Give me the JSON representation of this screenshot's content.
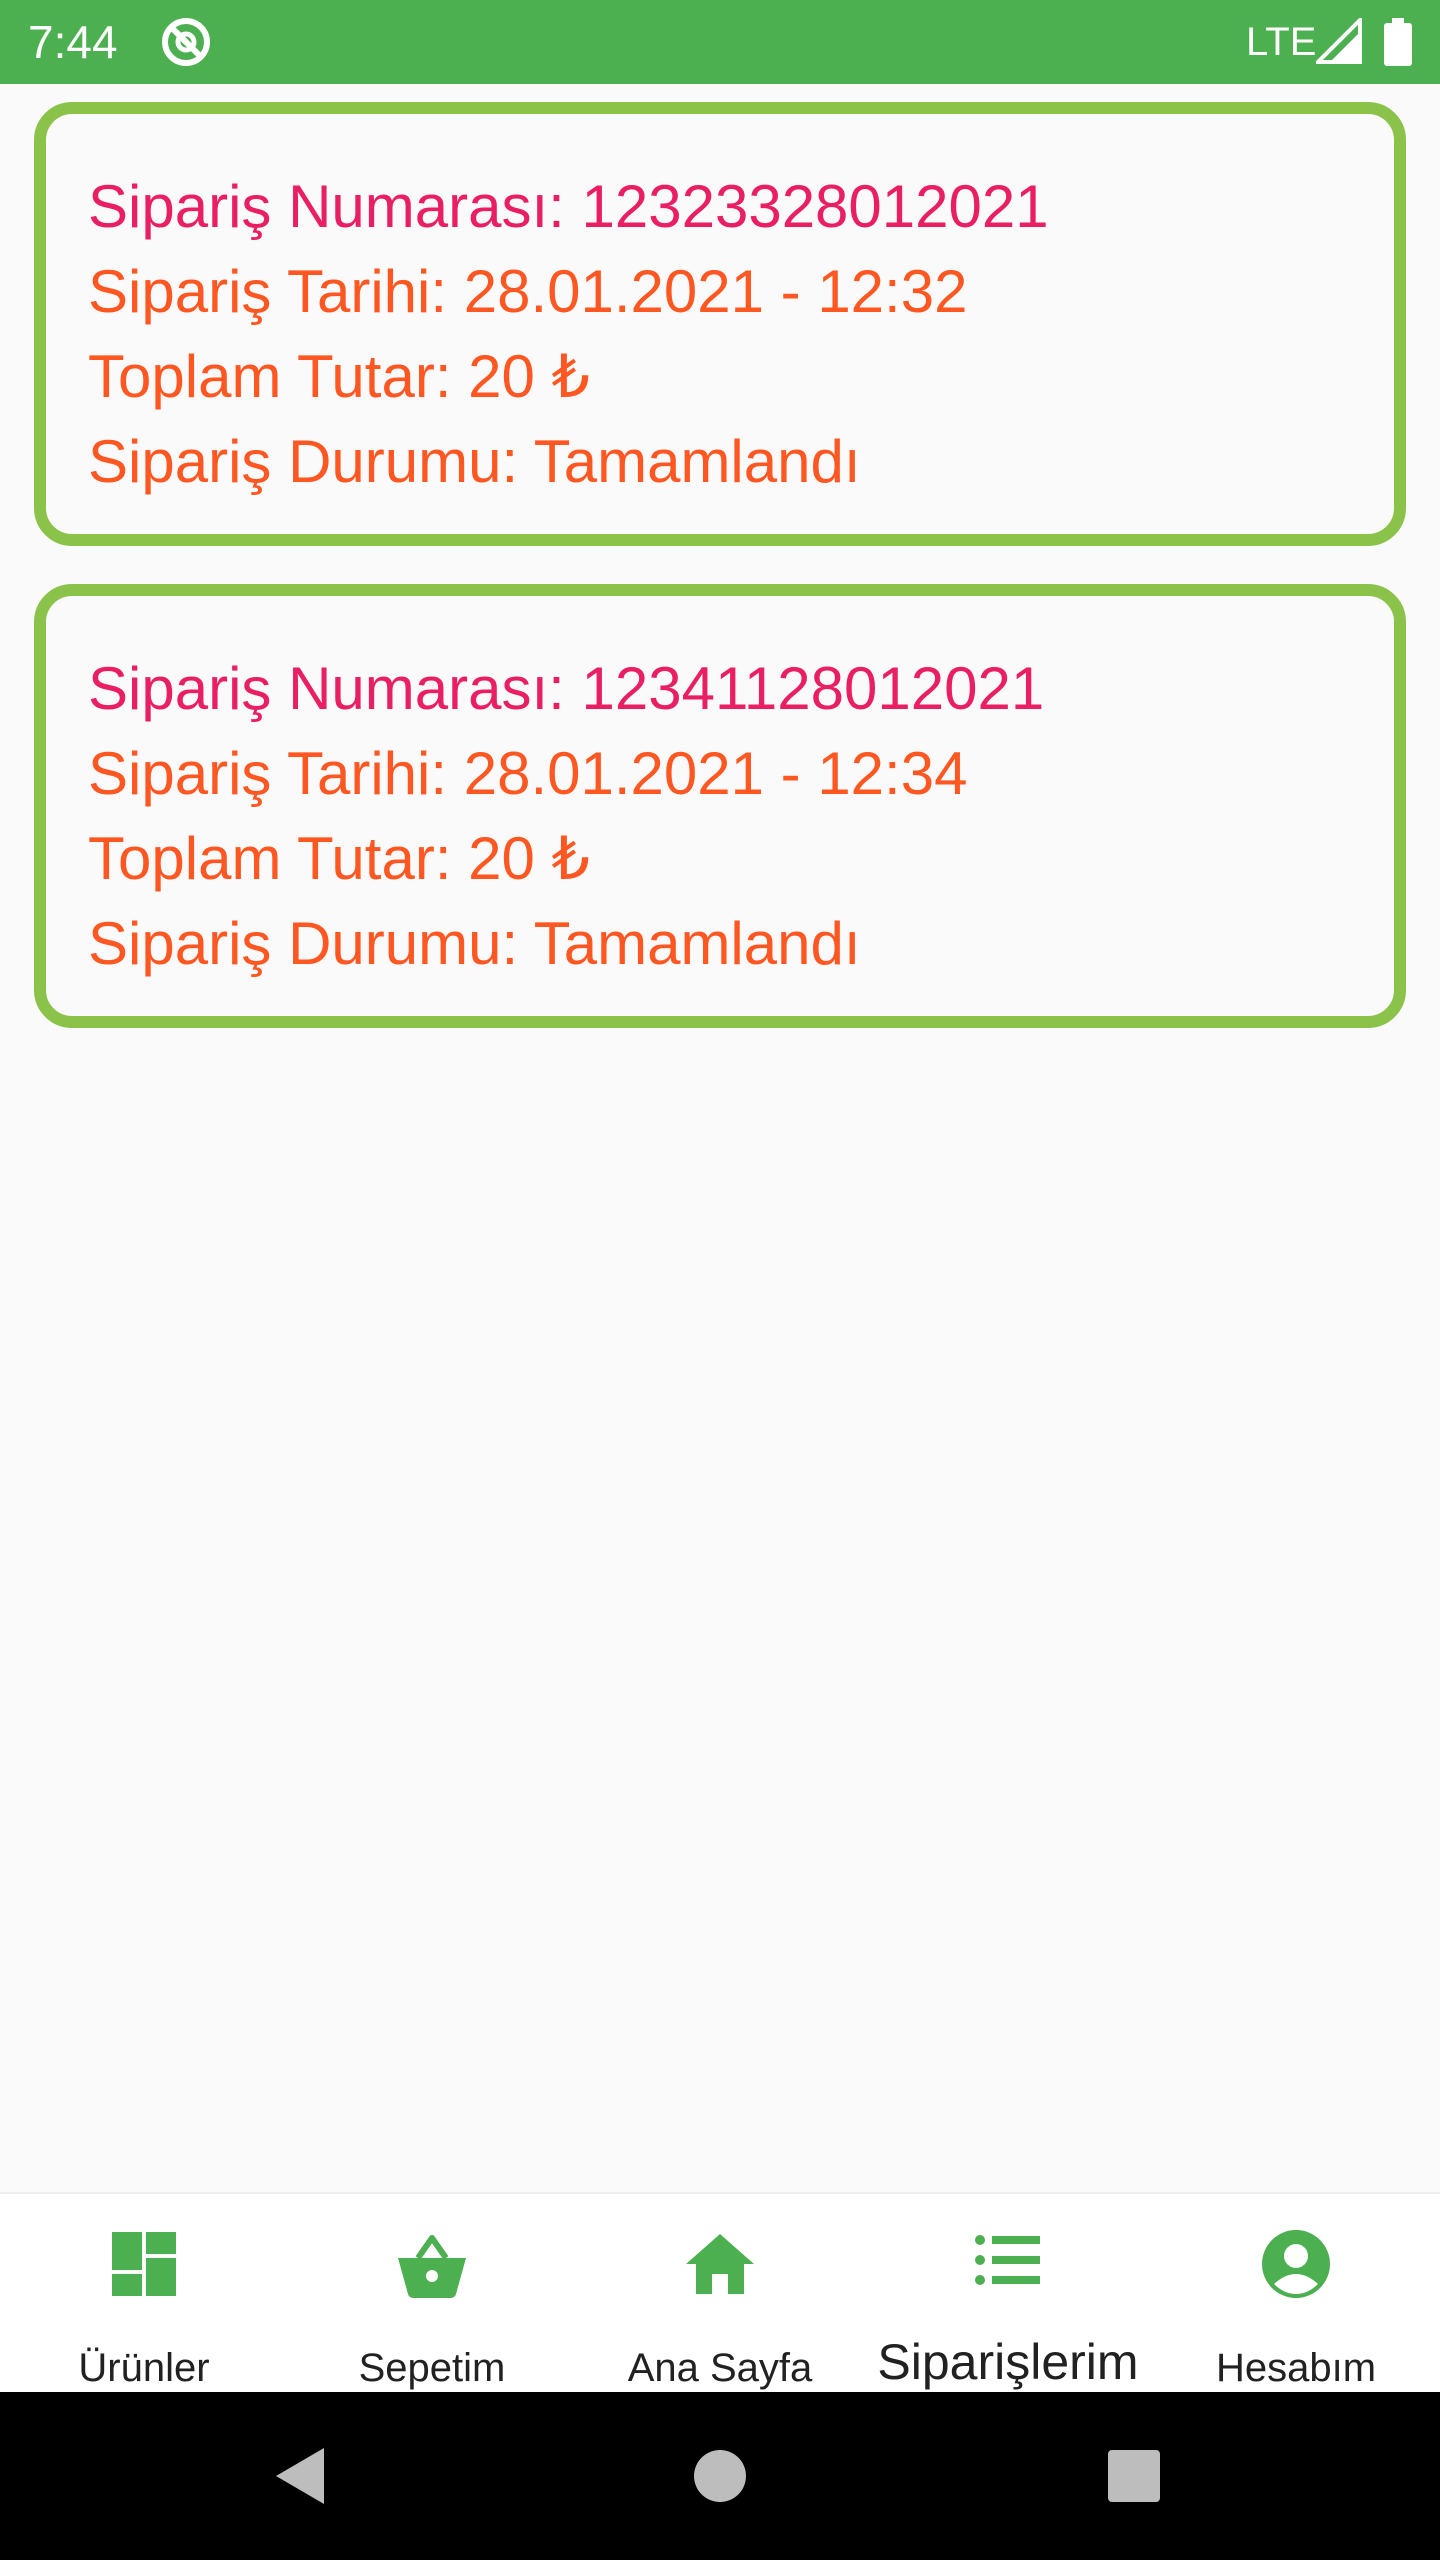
{
  "status_bar": {
    "time": "7:44",
    "network": "LTE",
    "icons": [
      "app-notification-icon",
      "signal-icon",
      "battery-icon"
    ],
    "background_color": "#4caf50"
  },
  "orders": [
    {
      "number_label": "Sipariş Numarası: 12323328012021",
      "date_label": "Sipariş Tarihi: 28.01.2021 - 12:32",
      "total_label": "Toplam Tutar: 20 ₺",
      "status_label": "Sipariş Durumu: Tamamlandı"
    },
    {
      "number_label": "Sipariş Numarası: 12341128012021",
      "date_label": "Sipariş Tarihi: 28.01.2021 - 12:34",
      "total_label": "Toplam Tutar: 20 ₺",
      "status_label": "Sipariş Durumu: Tamamlandı"
    }
  ],
  "bottom_nav": {
    "items": [
      {
        "label": "Ürünler",
        "icon": "dashboard-icon"
      },
      {
        "label": "Sepetim",
        "icon": "basket-icon"
      },
      {
        "label": "Ana Sayfa",
        "icon": "home-icon"
      },
      {
        "label": "Siparişlerim",
        "icon": "list-icon",
        "active": true
      },
      {
        "label": "Hesabım",
        "icon": "account-icon"
      }
    ],
    "icon_color": "#4caf50"
  },
  "colors": {
    "card_border": "#8bc34a",
    "order_number_text": "#e91e63",
    "order_detail_text": "#ff5722"
  }
}
